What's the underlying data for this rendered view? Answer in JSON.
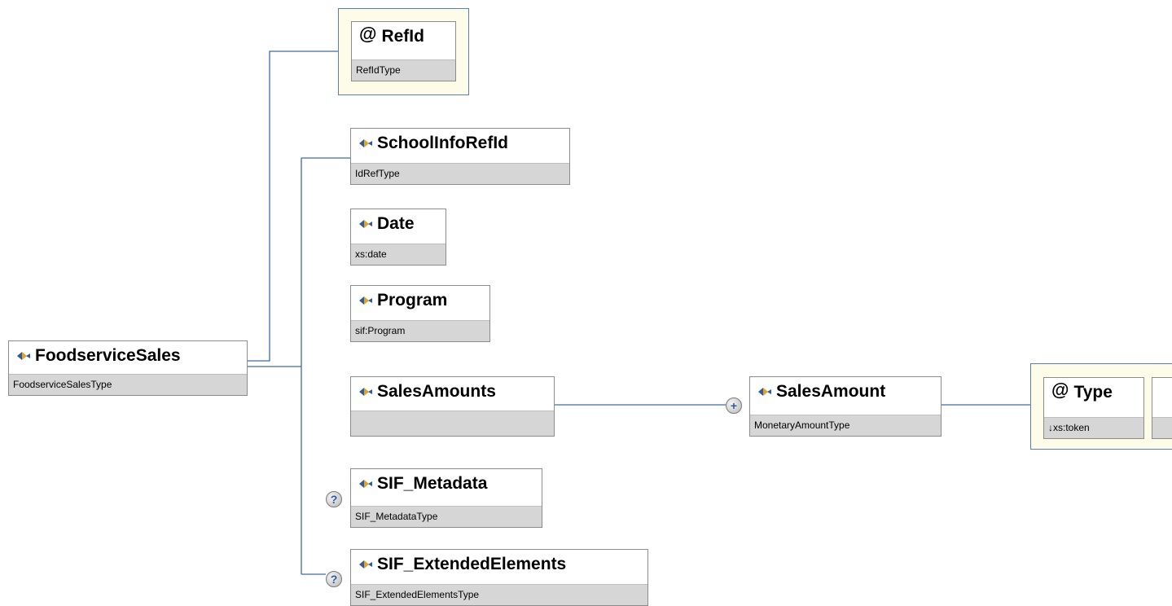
{
  "root": {
    "name": "FoodserviceSales",
    "type": "FoodserviceSalesType"
  },
  "attributes": [
    {
      "name": "RefId",
      "type": "RefIdType"
    }
  ],
  "children": [
    {
      "name": "SchoolInfoRefId",
      "type": "IdRefType",
      "optional": false
    },
    {
      "name": "Date",
      "type": "xs:date",
      "optional": false
    },
    {
      "name": "Program",
      "type": "sif:Program",
      "optional": false
    },
    {
      "name": "SalesAmounts",
      "type": "",
      "optional": false
    },
    {
      "name": "SIF_Metadata",
      "type": "SIF_MetadataType",
      "optional": true
    },
    {
      "name": "SIF_ExtendedElements",
      "type": "SIF_ExtendedElementsType",
      "optional": true
    }
  ],
  "sales_amount": {
    "name": "SalesAmount",
    "type": "MonetaryAmountType",
    "attribute": {
      "name": "Type",
      "type": "↓xs:token"
    }
  },
  "icons": {
    "element": "element-diamond-icon",
    "attribute": "at-sign-icon",
    "optional": "question-icon",
    "expand": "plus-icon"
  },
  "badges": {
    "optional": "?",
    "expand": "+",
    "attribute": "@"
  },
  "colors": {
    "connector": "#3f6aa8",
    "attr_group_bg": "#fdfce8",
    "type_bar": "#d6d6d6"
  }
}
